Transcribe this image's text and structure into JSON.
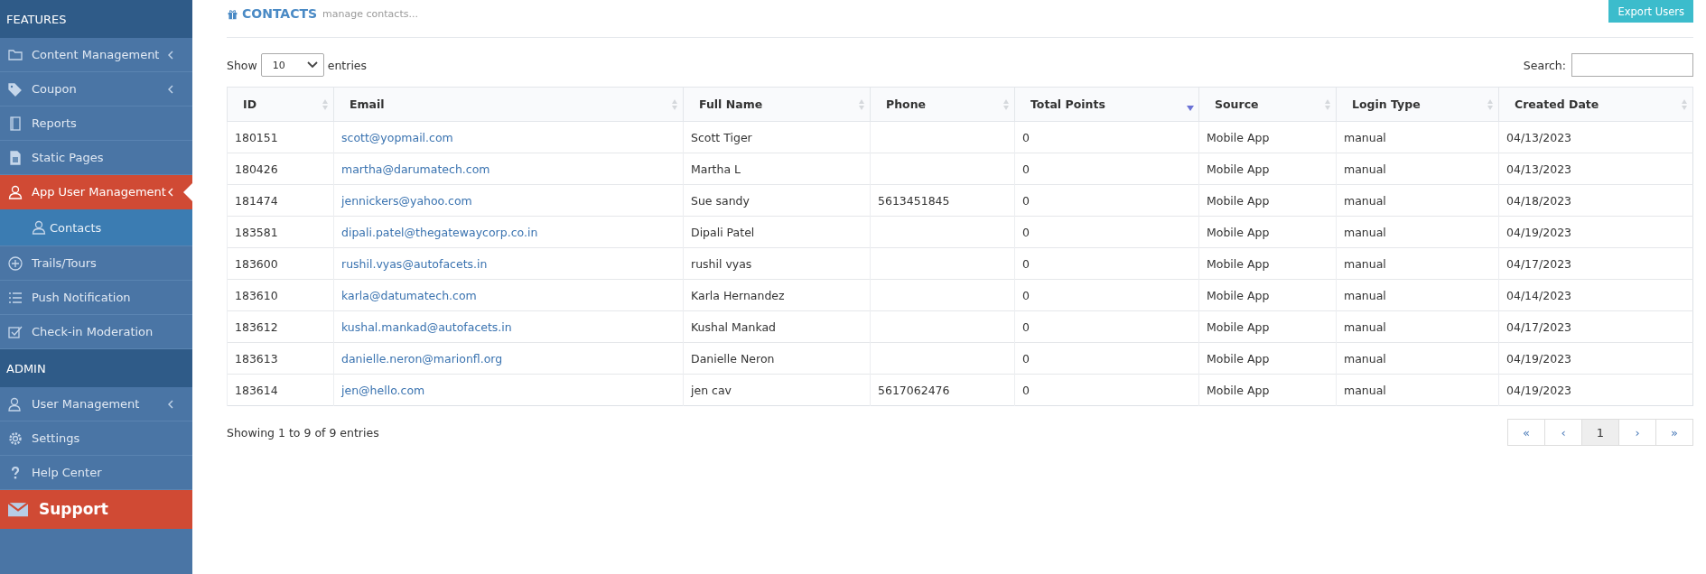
{
  "sidebar": {
    "items": [
      {
        "kind": "section",
        "label": "FEATURES"
      },
      {
        "kind": "item",
        "label": "Content Management",
        "submenu": true,
        "selected": false
      },
      {
        "kind": "item",
        "label": "Coupon",
        "submenu": true,
        "selected": false
      },
      {
        "kind": "item",
        "label": "Reports",
        "submenu": false,
        "selected": false
      },
      {
        "kind": "item",
        "label": "Static Pages",
        "submenu": false,
        "selected": false
      },
      {
        "kind": "item",
        "label": "App User Management",
        "submenu": true,
        "selected": true
      },
      {
        "kind": "subitem",
        "label": "Contacts",
        "submenu": false,
        "selected": true
      },
      {
        "kind": "item",
        "label": "Trails/Tours",
        "submenu": false,
        "selected": false
      },
      {
        "kind": "item",
        "label": "Push Notification",
        "submenu": false,
        "selected": false
      },
      {
        "kind": "item",
        "label": "Check-in Moderation",
        "submenu": false,
        "selected": false
      },
      {
        "kind": "section",
        "label": "ADMIN"
      },
      {
        "kind": "item",
        "label": "User Management",
        "submenu": true,
        "selected": false
      },
      {
        "kind": "item",
        "label": "Settings",
        "submenu": false,
        "selected": false
      },
      {
        "kind": "item",
        "label": "Help Center",
        "submenu": false,
        "selected": false
      },
      {
        "kind": "support",
        "label": "Support"
      }
    ]
  },
  "header": {
    "title": "CONTACTS",
    "subtitle": "manage contacts...",
    "export_button": "Export Users"
  },
  "length_control": {
    "prefix": "Show",
    "value": "10",
    "suffix": "entries"
  },
  "search": {
    "label": "Search:"
  },
  "table": {
    "columns": [
      {
        "label": "ID",
        "sorted": false
      },
      {
        "label": "Email",
        "sorted": false
      },
      {
        "label": "Full Name",
        "sorted": false
      },
      {
        "label": "Phone",
        "sorted": false
      },
      {
        "label": "Total Points",
        "sorted": true
      },
      {
        "label": "Source",
        "sorted": false
      },
      {
        "label": "Login Type",
        "sorted": false
      },
      {
        "label": "Created Date",
        "sorted": false
      }
    ],
    "rows": [
      [
        "180151",
        "scott@yopmail.com",
        "Scott Tiger",
        "",
        "0",
        "Mobile App",
        "manual",
        "04/13/2023"
      ],
      [
        "180426",
        "martha@darumatech.com",
        "Martha L",
        "",
        "0",
        "Mobile App",
        "manual",
        "04/13/2023"
      ],
      [
        "181474",
        "jennickers@yahoo.com",
        "Sue sandy",
        "5613451845",
        "0",
        "Mobile App",
        "manual",
        "04/18/2023"
      ],
      [
        "183581",
        "dipali.patel@thegatewaycorp.co.in",
        "Dipali Patel",
        "",
        "0",
        "Mobile App",
        "manual",
        "04/19/2023"
      ],
      [
        "183600",
        "rushil.vyas@autofacets.in",
        "rushil vyas",
        "",
        "0",
        "Mobile App",
        "manual",
        "04/17/2023"
      ],
      [
        "183610",
        "karla@datumatech.com",
        "Karla Hernandez",
        "",
        "0",
        "Mobile App",
        "manual",
        "04/14/2023"
      ],
      [
        "183612",
        "kushal.mankad@autofacets.in",
        "Kushal Mankad",
        "",
        "0",
        "Mobile App",
        "manual",
        "04/17/2023"
      ],
      [
        "183613",
        "danielle.neron@marionfl.org",
        "Danielle Neron",
        "",
        "0",
        "Mobile App",
        "manual",
        "04/19/2023"
      ],
      [
        "183614",
        "jen@hello.com",
        "jen cav",
        "5617062476",
        "0",
        "Mobile App",
        "manual",
        "04/19/2023"
      ]
    ]
  },
  "info": "Showing 1 to 9 of 9 entries",
  "pagination": [
    {
      "label": "«",
      "selected": false
    },
    {
      "label": "‹",
      "selected": false
    },
    {
      "label": "1",
      "selected": true
    },
    {
      "label": "›",
      "selected": false
    },
    {
      "label": "»",
      "selected": false
    }
  ]
}
